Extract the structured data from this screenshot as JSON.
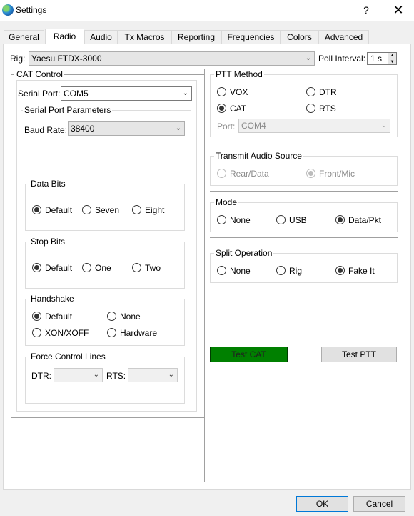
{
  "window": {
    "title": "Settings",
    "help": "?",
    "close": "✕"
  },
  "tabs": [
    "General",
    "Radio",
    "Audio",
    "Tx Macros",
    "Reporting",
    "Frequencies",
    "Colors",
    "Advanced"
  ],
  "rig": {
    "label": "Rig:",
    "value": "Yaesu FTDX-3000"
  },
  "poll": {
    "label": "Poll Interval:",
    "value": "1 s"
  },
  "cat": {
    "title": "CAT Control",
    "serial_port_label": "Serial Port:",
    "serial_port_value": "COM5",
    "params_title": "Serial Port Parameters",
    "baud_label": "Baud Rate:",
    "baud_value": "38400",
    "data_bits": {
      "title": "Data Bits",
      "options": [
        "Default",
        "Seven",
        "Eight"
      ],
      "selected": "Default"
    },
    "stop_bits": {
      "title": "Stop Bits",
      "options": [
        "Default",
        "One",
        "Two"
      ],
      "selected": "Default"
    },
    "handshake": {
      "title": "Handshake",
      "options": [
        "Default",
        "None",
        "XON/XOFF",
        "Hardware"
      ],
      "selected": "Default"
    },
    "force": {
      "title": "Force Control Lines",
      "dtr_label": "DTR:",
      "rts_label": "RTS:",
      "dtr_value": "",
      "rts_value": ""
    }
  },
  "ptt": {
    "title": "PTT Method",
    "options": [
      "VOX",
      "DTR",
      "CAT",
      "RTS"
    ],
    "selected": "CAT",
    "port_label": "Port:",
    "port_value": "COM4"
  },
  "tx_audio": {
    "title": "Transmit Audio Source",
    "options": [
      "Rear/Data",
      "Front/Mic"
    ],
    "selected": "Front/Mic"
  },
  "mode": {
    "title": "Mode",
    "options": [
      "None",
      "USB",
      "Data/Pkt"
    ],
    "selected": "Data/Pkt"
  },
  "split": {
    "title": "Split Operation",
    "options": [
      "None",
      "Rig",
      "Fake It"
    ],
    "selected": "Fake It"
  },
  "buttons": {
    "test_cat": "Test CAT",
    "test_ptt": "Test PTT",
    "ok": "OK",
    "cancel": "Cancel"
  },
  "colors": {
    "test_cat_bg": "#008000",
    "accent": "#0078d7"
  }
}
